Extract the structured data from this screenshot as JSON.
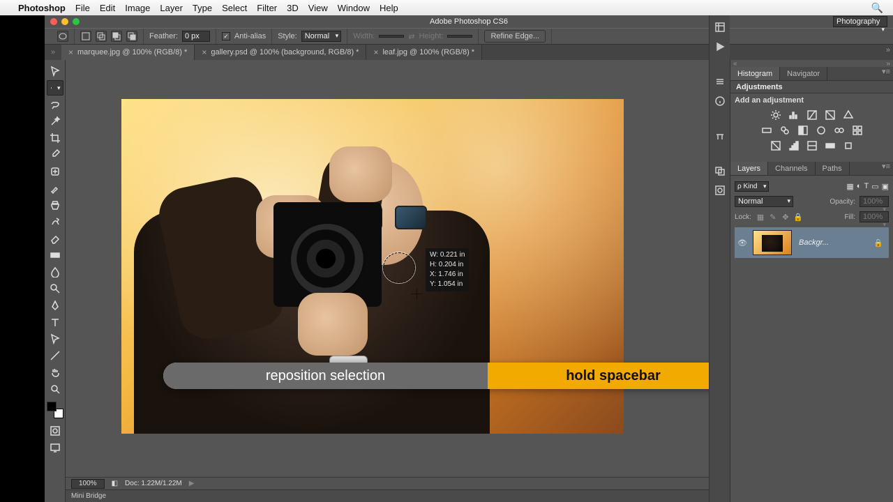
{
  "os_menu": {
    "app": "Photoshop",
    "items": [
      "File",
      "Edit",
      "Image",
      "Layer",
      "Type",
      "Select",
      "Filter",
      "3D",
      "View",
      "Window",
      "Help"
    ]
  },
  "title": "Adobe Photoshop CS6",
  "options": {
    "feather_label": "Feather:",
    "feather_value": "0 px",
    "antialias": "Anti-alias",
    "antialias_checked": "✓",
    "style_label": "Style:",
    "style_value": "Normal",
    "width_label": "Width:",
    "height_label": "Height:",
    "refine": "Refine Edge...",
    "workspace": "Photography"
  },
  "tabs": [
    {
      "label": "marquee.jpg @ 100% (RGB/8) *",
      "active": true
    },
    {
      "label": "gallery.psd @ 100% (background, RGB/8) *",
      "active": false
    },
    {
      "label": "leaf.jpg @ 100% (RGB/8) *",
      "active": false
    }
  ],
  "readout": {
    "w": "W: 0.221 in",
    "h": "H: 0.204 in",
    "x": "X: 1.746 in",
    "y": "Y: 1.054 in"
  },
  "hint": {
    "left": "reposition selection",
    "right": "hold spacebar"
  },
  "status": {
    "zoom": "100%",
    "doc": "Doc: 1.22M/1.22M"
  },
  "minibridge": "Mini Bridge",
  "panels": {
    "hist_tabs": [
      "Histogram",
      "Navigator"
    ],
    "adjustments": "Adjustments",
    "add_adjustment": "Add an adjustment",
    "layer_tabs": [
      "Layers",
      "Channels",
      "Paths"
    ],
    "kind": "Kind",
    "blend": "Normal",
    "opacity_label": "Opacity:",
    "opacity_value": "100%",
    "lock_label": "Lock:",
    "fill_label": "Fill:",
    "fill_value": "100%",
    "layer_name": "Backgr..."
  }
}
